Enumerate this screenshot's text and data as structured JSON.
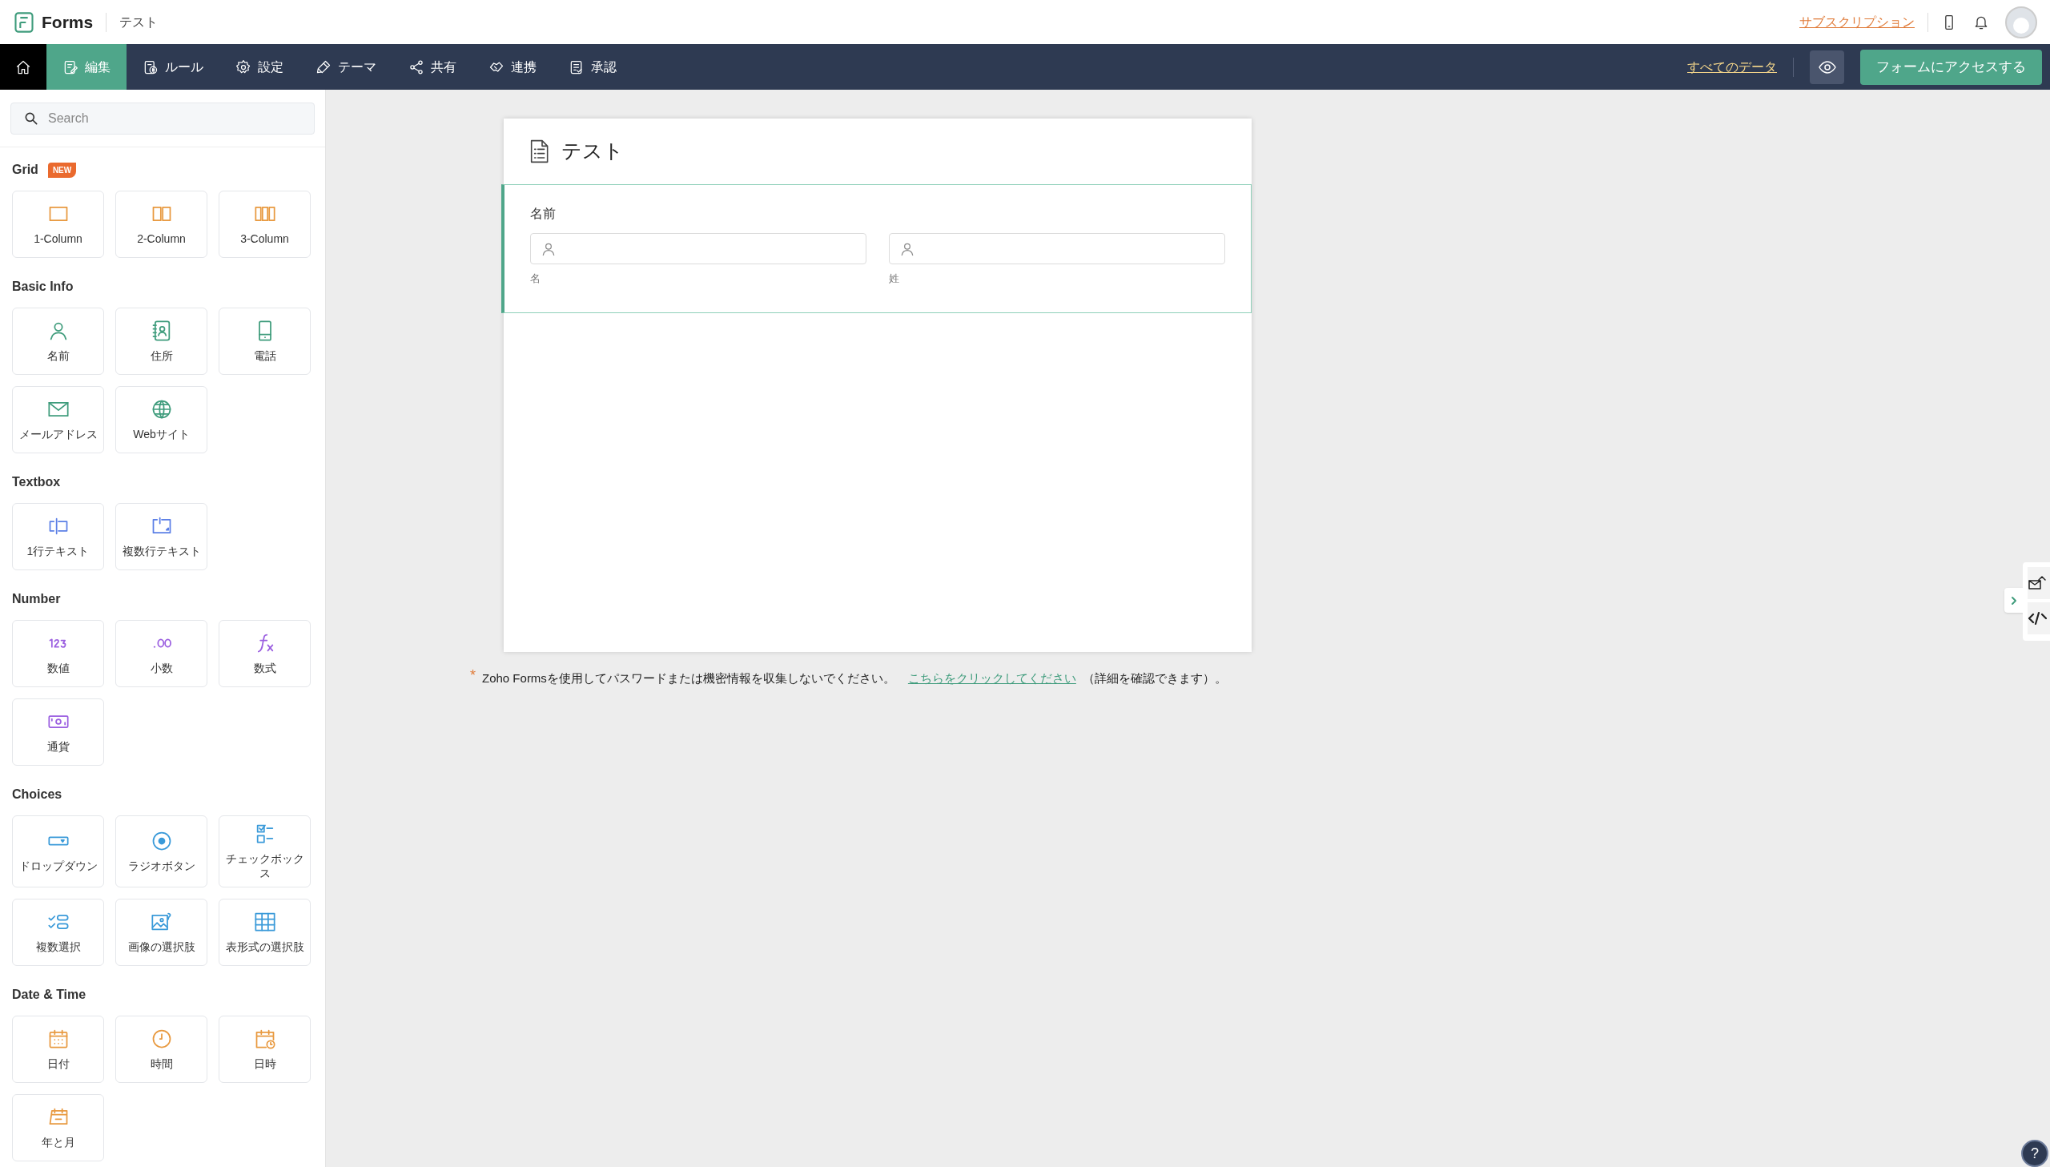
{
  "header": {
    "app_name": "Forms",
    "form_name": "テスト",
    "subscription_link": "サブスクリプション"
  },
  "nav": {
    "tabs": [
      {
        "label": "編集",
        "selected": true
      },
      {
        "label": "ルール",
        "selected": false
      },
      {
        "label": "設定",
        "selected": false
      },
      {
        "label": "テーマ",
        "selected": false
      },
      {
        "label": "共有",
        "selected": false
      },
      {
        "label": "連携",
        "selected": false
      },
      {
        "label": "承認",
        "selected": false
      }
    ],
    "all_data_link": "すべてのデータ",
    "access_button": "フォームにアクセスする"
  },
  "sidebar": {
    "search": {
      "placeholder": "Search"
    },
    "sections": [
      {
        "title": "Grid",
        "badge": "NEW",
        "items": [
          "1-Column",
          "2-Column",
          "3-Column"
        ]
      },
      {
        "title": "Basic Info",
        "items": [
          "名前",
          "住所",
          "電話",
          "メールアドレス",
          "Webサイト"
        ]
      },
      {
        "title": "Textbox",
        "items": [
          "1行テキスト",
          "複数行テキスト"
        ]
      },
      {
        "title": "Number",
        "items": [
          "数値",
          "小数",
          "数式",
          "通貨"
        ]
      },
      {
        "title": "Choices",
        "items": [
          "ドロップダウン",
          "ラジオボタン",
          "チェックボックス",
          "複数選択",
          "画像の選択肢",
          "表形式の選択肢"
        ]
      },
      {
        "title": "Date & Time",
        "items": [
          "日付",
          "時間",
          "日時",
          "年と月"
        ]
      }
    ]
  },
  "form": {
    "title": "テスト",
    "fields": [
      {
        "label": "名前",
        "selected": true,
        "subfields": [
          "名",
          "姓"
        ]
      }
    ],
    "note": {
      "mark": "*",
      "text": "Zoho Formsを使用してパスワードまたは機密情報を収集しないでください。",
      "link": "こちらをクリックしてください",
      "suffix": "（詳細を確認できます）。"
    }
  },
  "help_button": "?"
}
